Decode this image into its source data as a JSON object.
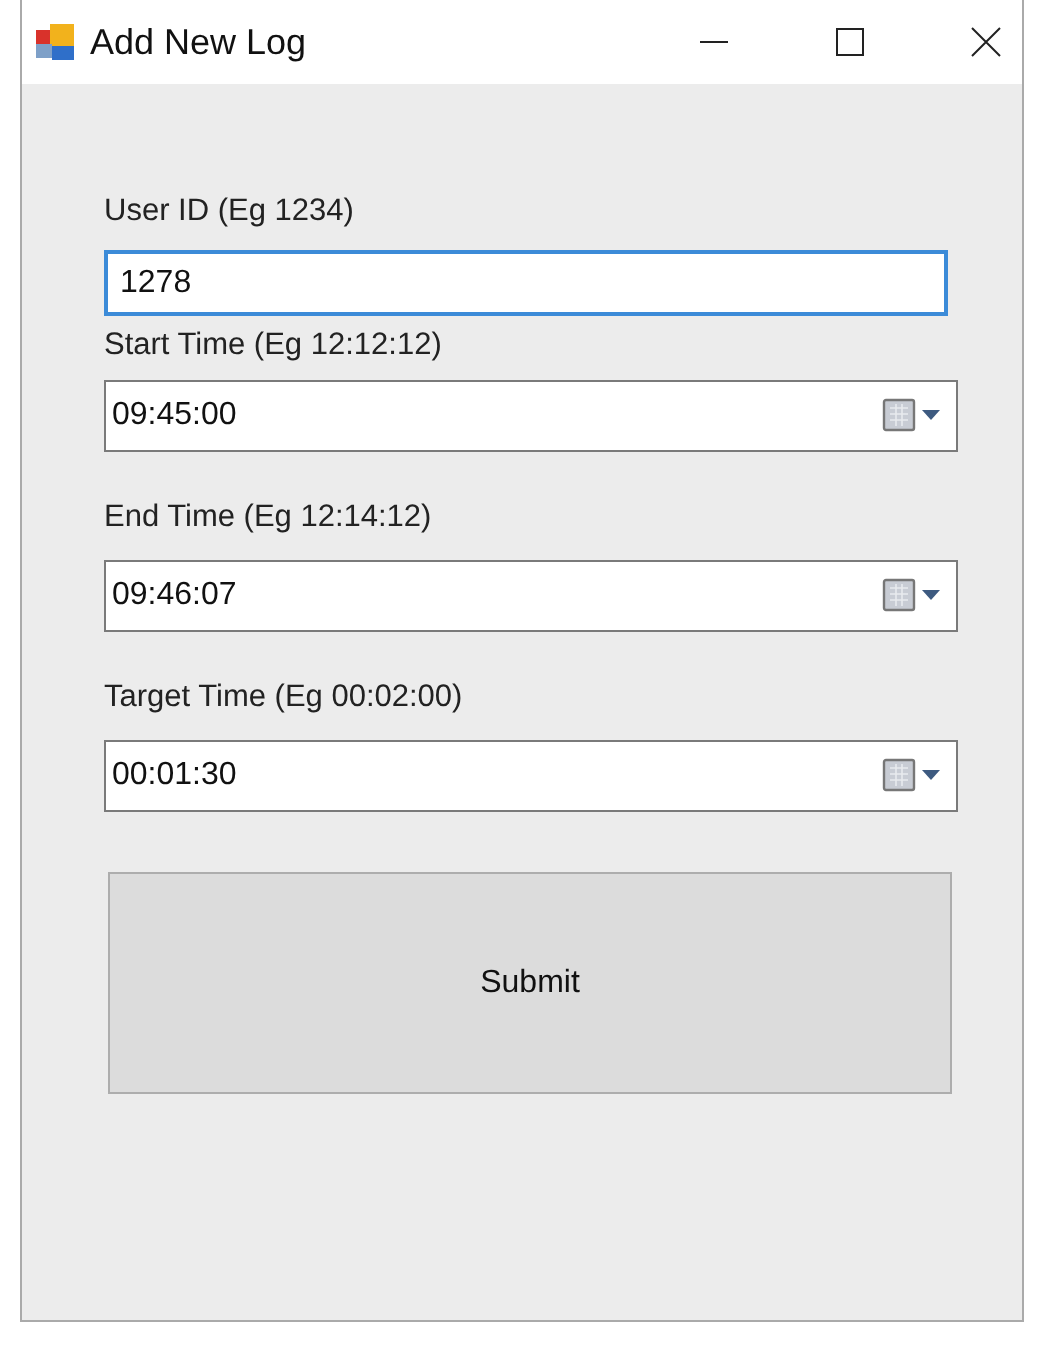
{
  "window": {
    "title": "Add New Log"
  },
  "fields": [
    {
      "kind": "text",
      "label": "User ID (Eg 1234)",
      "value": "1278",
      "focused": true
    },
    {
      "kind": "time",
      "label": "Start Time (Eg 12:12:12)",
      "value": "09:45:00",
      "focused": false
    },
    {
      "kind": "time",
      "label": "End Time (Eg 12:14:12)",
      "value": "09:46:07",
      "focused": false
    },
    {
      "kind": "time",
      "label": "Target Time (Eg 00:02:00)",
      "value": "00:01:30",
      "focused": false
    }
  ],
  "submit": "Submit"
}
